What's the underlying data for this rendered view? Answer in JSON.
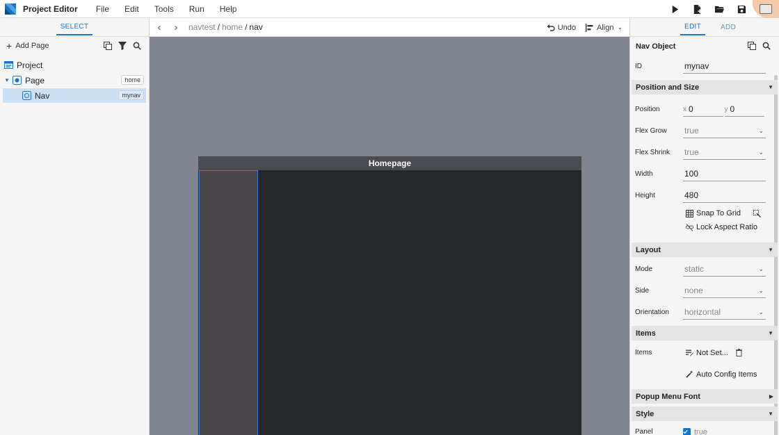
{
  "app": {
    "title": "Project Editor",
    "menu": [
      "File",
      "Edit",
      "Tools",
      "Run",
      "Help"
    ]
  },
  "left": {
    "tab_label": "SELECT",
    "add_page_label": "Add Page",
    "tree": [
      {
        "label": "Project",
        "badge": ""
      },
      {
        "label": "Page",
        "badge": "home"
      },
      {
        "label": "Nav",
        "badge": "mynav"
      }
    ]
  },
  "center": {
    "breadcrumb": [
      "navtest",
      "home",
      "nav"
    ],
    "undo_label": "Undo",
    "align_label": "Align",
    "page_title": "Homepage"
  },
  "right": {
    "tabs": [
      "EDIT",
      "ADD"
    ],
    "object_title": "Nav Object",
    "id_label": "ID",
    "id_value": "mynav",
    "sections": {
      "position_size": "Position and Size",
      "layout": "Layout",
      "items": "Items",
      "popup_font": "Popup Menu Font",
      "style": "Style"
    },
    "position": {
      "label": "Position",
      "x_axis": "x",
      "x": "0",
      "y_axis": "y",
      "y": "0"
    },
    "flex_grow": {
      "label": "Flex Grow",
      "value": "true"
    },
    "flex_shrink": {
      "label": "Flex Shrink",
      "value": "true"
    },
    "width": {
      "label": "Width",
      "value": "100"
    },
    "height": {
      "label": "Height",
      "value": "480"
    },
    "snap_label": "Snap To Grid",
    "lock_label": "Lock Aspect Ratio",
    "mode": {
      "label": "Mode",
      "value": "static"
    },
    "side": {
      "label": "Side",
      "value": "none"
    },
    "orientation": {
      "label": "Orientation",
      "value": "horizontal"
    },
    "items": {
      "label": "Items",
      "value": "Not Set..."
    },
    "auto_config_label": "Auto Config Items",
    "panel": {
      "label": "Panel",
      "value": "true"
    }
  },
  "colors": {
    "accent": "#1b73c7",
    "canvas_bg": "#818592",
    "page_bg": "#27282c",
    "nav_bg": "#48464b",
    "highlight": "#f3c9a7"
  }
}
